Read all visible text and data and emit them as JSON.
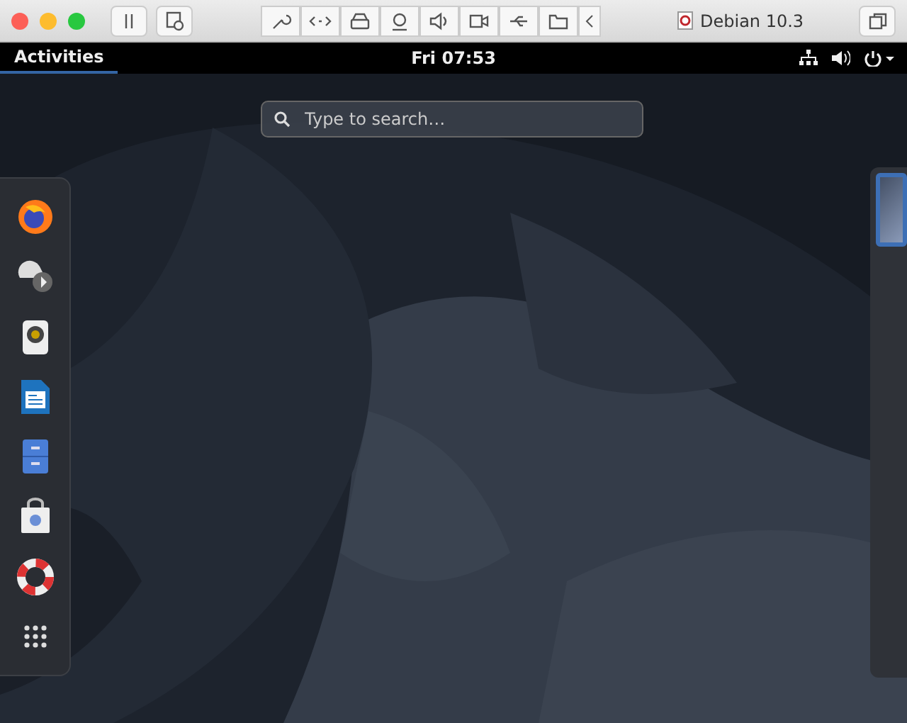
{
  "window": {
    "title": "Debian 10.3"
  },
  "topbar": {
    "activities": {
      "label": "Activities",
      "selected": true
    },
    "clock": "Fri 07:53"
  },
  "search": {
    "placeholder": "Type to search…"
  }
}
